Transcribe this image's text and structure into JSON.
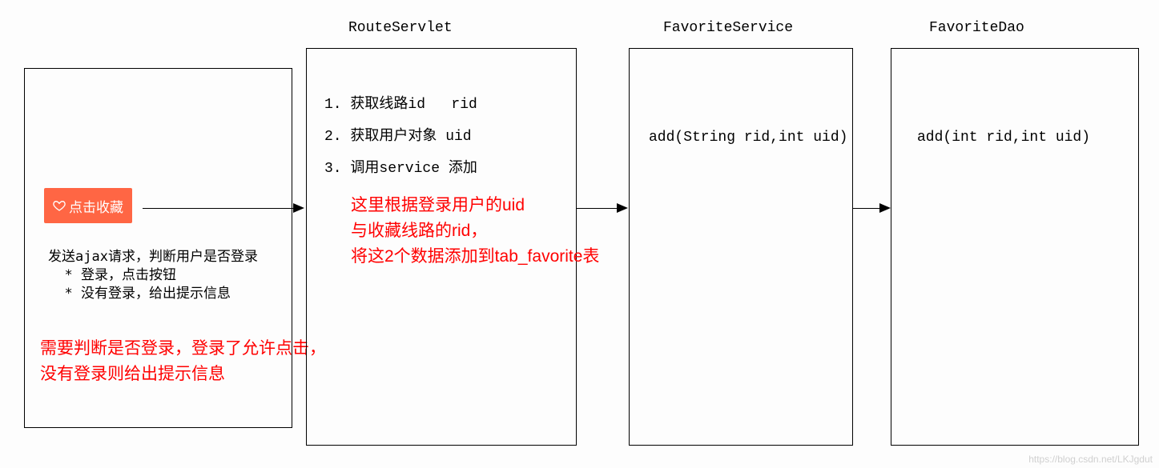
{
  "titles": {
    "routeServlet": "RouteServlet",
    "favoriteService": "FavoriteService",
    "favoriteDao": "FavoriteDao"
  },
  "box1": {
    "button_label": "点击收藏",
    "desc_line1": "发送ajax请求，判断用户是否登录",
    "desc_line2": "  * 登录，点击按钮",
    "desc_line3": "  * 没有登录，给出提示信息",
    "red_note_line1": "需要判断是否登录，登录了允许点击，",
    "red_note_line2": "没有登录则给出提示信息"
  },
  "box2": {
    "item1": "1. 获取线路id   rid",
    "item2": "2. 获取用户对象 uid",
    "item3": "3. 调用service 添加",
    "red_note_line1": "这里根据登录用户的uid",
    "red_note_line2": "与收藏线路的rid，",
    "red_note_line3": "将这2个数据添加到tab_favorite表"
  },
  "box3": {
    "method": "add(String rid,int uid)"
  },
  "box4": {
    "method": "add(int rid,int uid)"
  },
  "watermark": "https://blog.csdn.net/LKJgdut"
}
